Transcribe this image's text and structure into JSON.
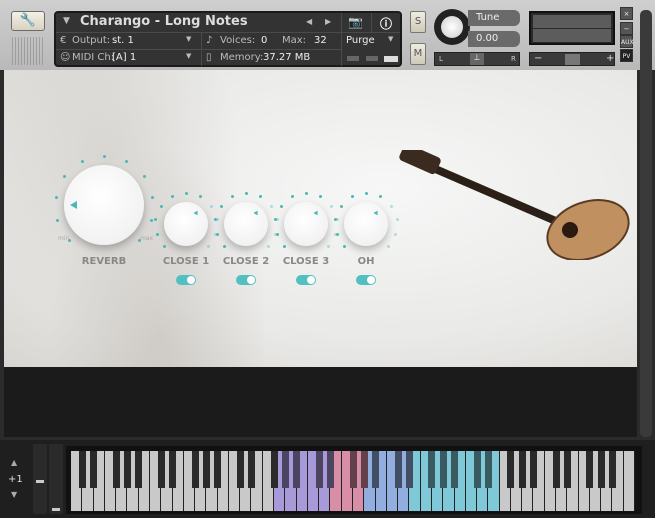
{
  "header": {
    "title": "Charango - Long Notes",
    "output_label": "Output:",
    "output_value": "st. 1",
    "voices_label": "Voices:",
    "voices_value": "0",
    "max_label": "Max:",
    "max_value": "32",
    "purge_label": "Purge",
    "midi_label": "MIDI Ch:",
    "midi_value": "[A]  1",
    "memory_label": "Memory:",
    "memory_value": "37.27 MB"
  },
  "controls": {
    "solo": "S",
    "mute": "M",
    "tune_label": "Tune",
    "tune_value": "0.00",
    "pan_left": "L",
    "pan_right": "R",
    "vol_minus": "−",
    "vol_plus": "+",
    "close": "×",
    "minimize": "−",
    "aux": "AUX",
    "pv": "PV"
  },
  "panel": {
    "knobs": [
      {
        "label": "REVERB",
        "min": "min",
        "max": "max"
      },
      {
        "label": "CLOSE 1"
      },
      {
        "label": "CLOSE 2"
      },
      {
        "label": "CLOSE 3"
      },
      {
        "label": "OH"
      }
    ],
    "mic_toggles": [
      true,
      true,
      true,
      true
    ]
  },
  "keyboard": {
    "octave_shift": "+1",
    "white_keys": 50,
    "zones": [
      {
        "name": "purple",
        "from": 18,
        "to": 23,
        "color": "#a89ad8"
      },
      {
        "name": "pink",
        "from": 23,
        "to": 26,
        "color": "#d98ea8"
      },
      {
        "name": "blue",
        "from": 26,
        "to": 30,
        "color": "#92aede"
      },
      {
        "name": "cyan",
        "from": 30,
        "to": 38,
        "color": "#7ec8d8"
      }
    ]
  }
}
